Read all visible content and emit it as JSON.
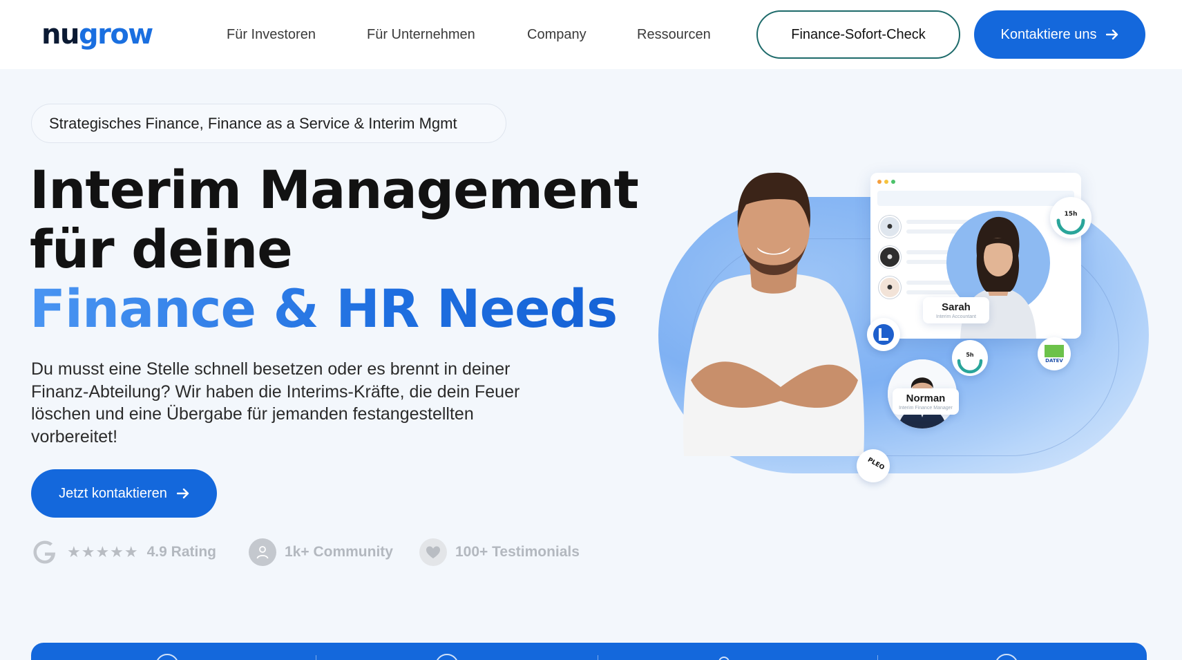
{
  "header": {
    "logo_part1": "nu",
    "logo_part2": "grow",
    "nav": [
      "Für Investoren",
      "Für Unternehmen",
      "Company",
      "Ressourcen"
    ],
    "check_button": "Finance-Sofort-Check",
    "contact_button": "Kontaktiere uns"
  },
  "hero": {
    "badge": "Strategisches Finance, Finance as a Service & Interim Mgmt",
    "headline_line1": "Interim Management",
    "headline_line2": "für deine",
    "headline_line3": "Finance & HR Needs",
    "lead": "Du musst eine Stelle schnell besetzen oder es brennt in deiner Finanz-Abteilung? Wir haben die Interims-Kräfte, die dein Feuer löschen und eine Übergabe für jemanden festangestellten vorbereitet!",
    "cta": "Jetzt kontaktieren",
    "stats": {
      "rating_stars": "★★★★★",
      "rating": "4.9 Rating",
      "community": "1k+ Community",
      "testimonials": "100+ Testimonials"
    }
  },
  "illustration": {
    "sarah_name": "Sarah",
    "sarah_role": "Interim Accountant",
    "norman_name": "Norman",
    "norman_role": "Interim Finance Manager",
    "gauge_top": "15h",
    "gauge_mid": "5h",
    "datev_label": "DATEV",
    "pleo_label": "PLEO"
  },
  "colors": {
    "primary": "#1468dc",
    "accent_gradient_start": "#4a95f2",
    "outline_border": "#1d6a6a",
    "background": "#f3f7fc"
  },
  "icons": [
    "arrow-right-icon",
    "google-icon",
    "user-icon",
    "heart-icon"
  ]
}
